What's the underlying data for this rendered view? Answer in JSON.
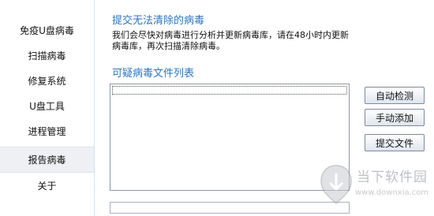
{
  "sidebar": {
    "items": [
      {
        "label": "免疫U盘病毒"
      },
      {
        "label": "扫描病毒"
      },
      {
        "label": "修复系统"
      },
      {
        "label": "U盘工具"
      },
      {
        "label": "进程管理"
      },
      {
        "label": "报告病毒",
        "active": true
      },
      {
        "label": "关于"
      }
    ]
  },
  "main": {
    "title": "提交无法清除的病毒",
    "description": "我们会尽快对病毒进行分析并更新病毒库，请在48小时内更新病毒库，再次扫描清除病毒。",
    "list_title": "可疑病毒文件列表",
    "path_value": "",
    "buttons": {
      "auto_detect": "自动检测",
      "manual_add": "手动添加",
      "submit_file": "提交文件"
    }
  },
  "watermark": {
    "name": "当下软件园",
    "url": "www.downxia.com"
  }
}
